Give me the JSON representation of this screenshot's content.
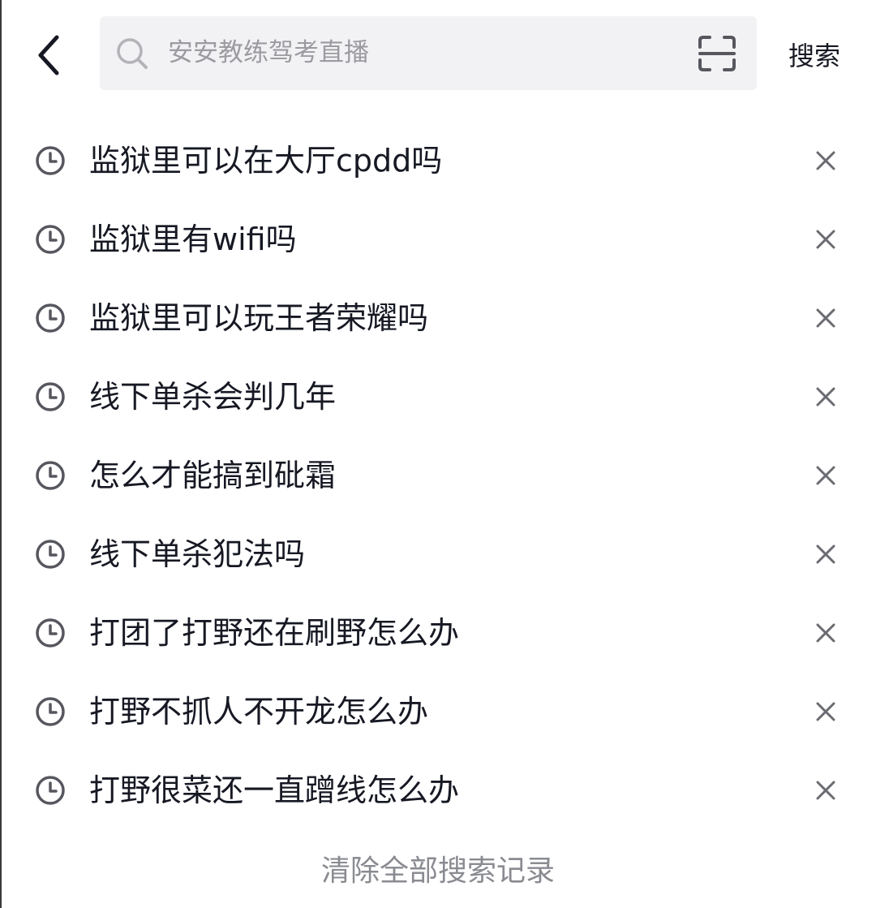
{
  "header": {
    "back_icon": "chevron-left-icon",
    "search_placeholder": "安安教练驾考直播",
    "search_icon": "search-icon",
    "scan_icon": "scan-icon",
    "search_button_label": "搜索"
  },
  "history": {
    "items": [
      {
        "text": "监狱里可以在大厅cpdd吗"
      },
      {
        "text": "监狱里有wifi吗"
      },
      {
        "text": "监狱里可以玩王者荣耀吗"
      },
      {
        "text": "线下单杀会判几年"
      },
      {
        "text": "怎么才能搞到砒霜"
      },
      {
        "text": "线下单杀犯法吗"
      },
      {
        "text": "打团了打野还在刷野怎么办"
      },
      {
        "text": "打野不抓人不开龙怎么办"
      },
      {
        "text": "打野很菜还一直蹭线怎么办"
      }
    ],
    "item_icon": "clock-icon",
    "delete_icon": "close-icon",
    "clear_all_label": "清除全部搜索记录"
  },
  "colors": {
    "text_primary": "#161823",
    "text_secondary": "#8a8b91",
    "search_bg": "#f2f2f4",
    "icon_gray": "#56575e"
  }
}
